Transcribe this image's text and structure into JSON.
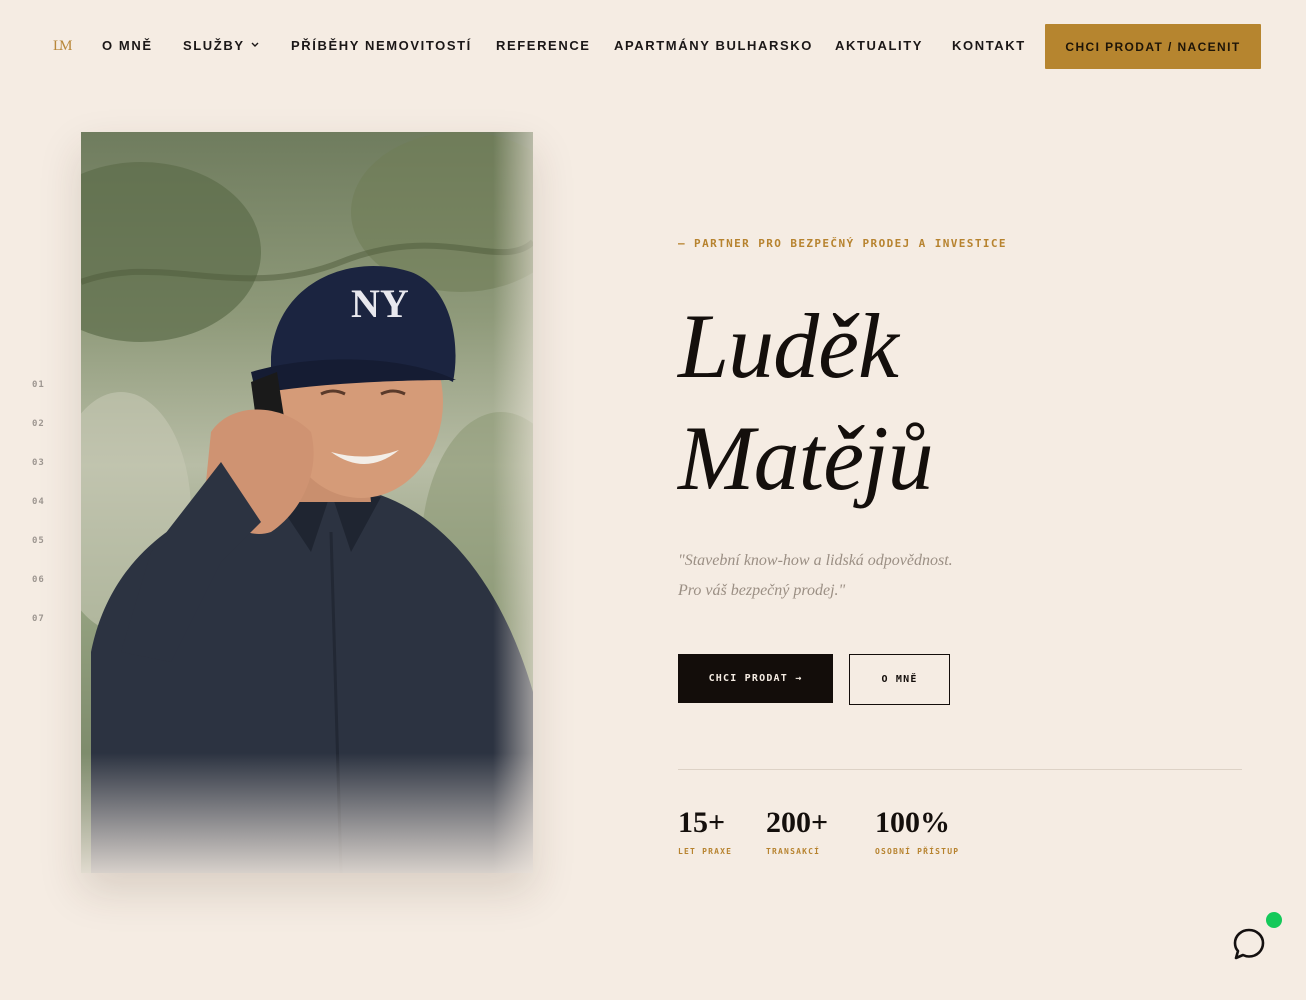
{
  "header": {
    "logo_text": "LM",
    "nav": [
      {
        "label": "O MNĚ"
      },
      {
        "label": "SLUŽBY",
        "has_dropdown": true
      },
      {
        "label": "PŘÍBĚHY NEMOVITOSTÍ"
      },
      {
        "label": "REFERENCE"
      },
      {
        "label": "APARTMÁNY BULHARSKO"
      },
      {
        "label": "AKTUALITY"
      },
      {
        "label": "KONTAKT"
      }
    ],
    "cta_label": "CHCI PRODAT / NACENIT"
  },
  "side_nav": [
    "01",
    "02",
    "03",
    "04",
    "05",
    "06",
    "07"
  ],
  "hero": {
    "eyebrow": "— PARTNER PRO BEZPEČNÝ PRODEJ A INVESTICE",
    "first_name": "Luděk",
    "last_name": "Matějů",
    "quote_line1": "\"Stavební know-how a lidská odpovědnost.",
    "quote_line2": "Pro váš bezpečný prodej.\"",
    "primary_button": "CHCI PRODAT →",
    "secondary_button": "O MNĚ"
  },
  "stats": [
    {
      "value": "15+",
      "label": "LET PRAXE"
    },
    {
      "value": "200+",
      "label": "TRANSAKCÍ"
    },
    {
      "value": "100%",
      "label": "OSOBNÍ PŘÍSTUP"
    }
  ],
  "colors": {
    "background": "#f5ece3",
    "accent_gold": "#b6852f",
    "dark": "#130d0a",
    "chat_online": "#14c95a"
  },
  "icons": {
    "dropdown": "chevron-down-icon",
    "chat": "chat-bubble-icon"
  }
}
